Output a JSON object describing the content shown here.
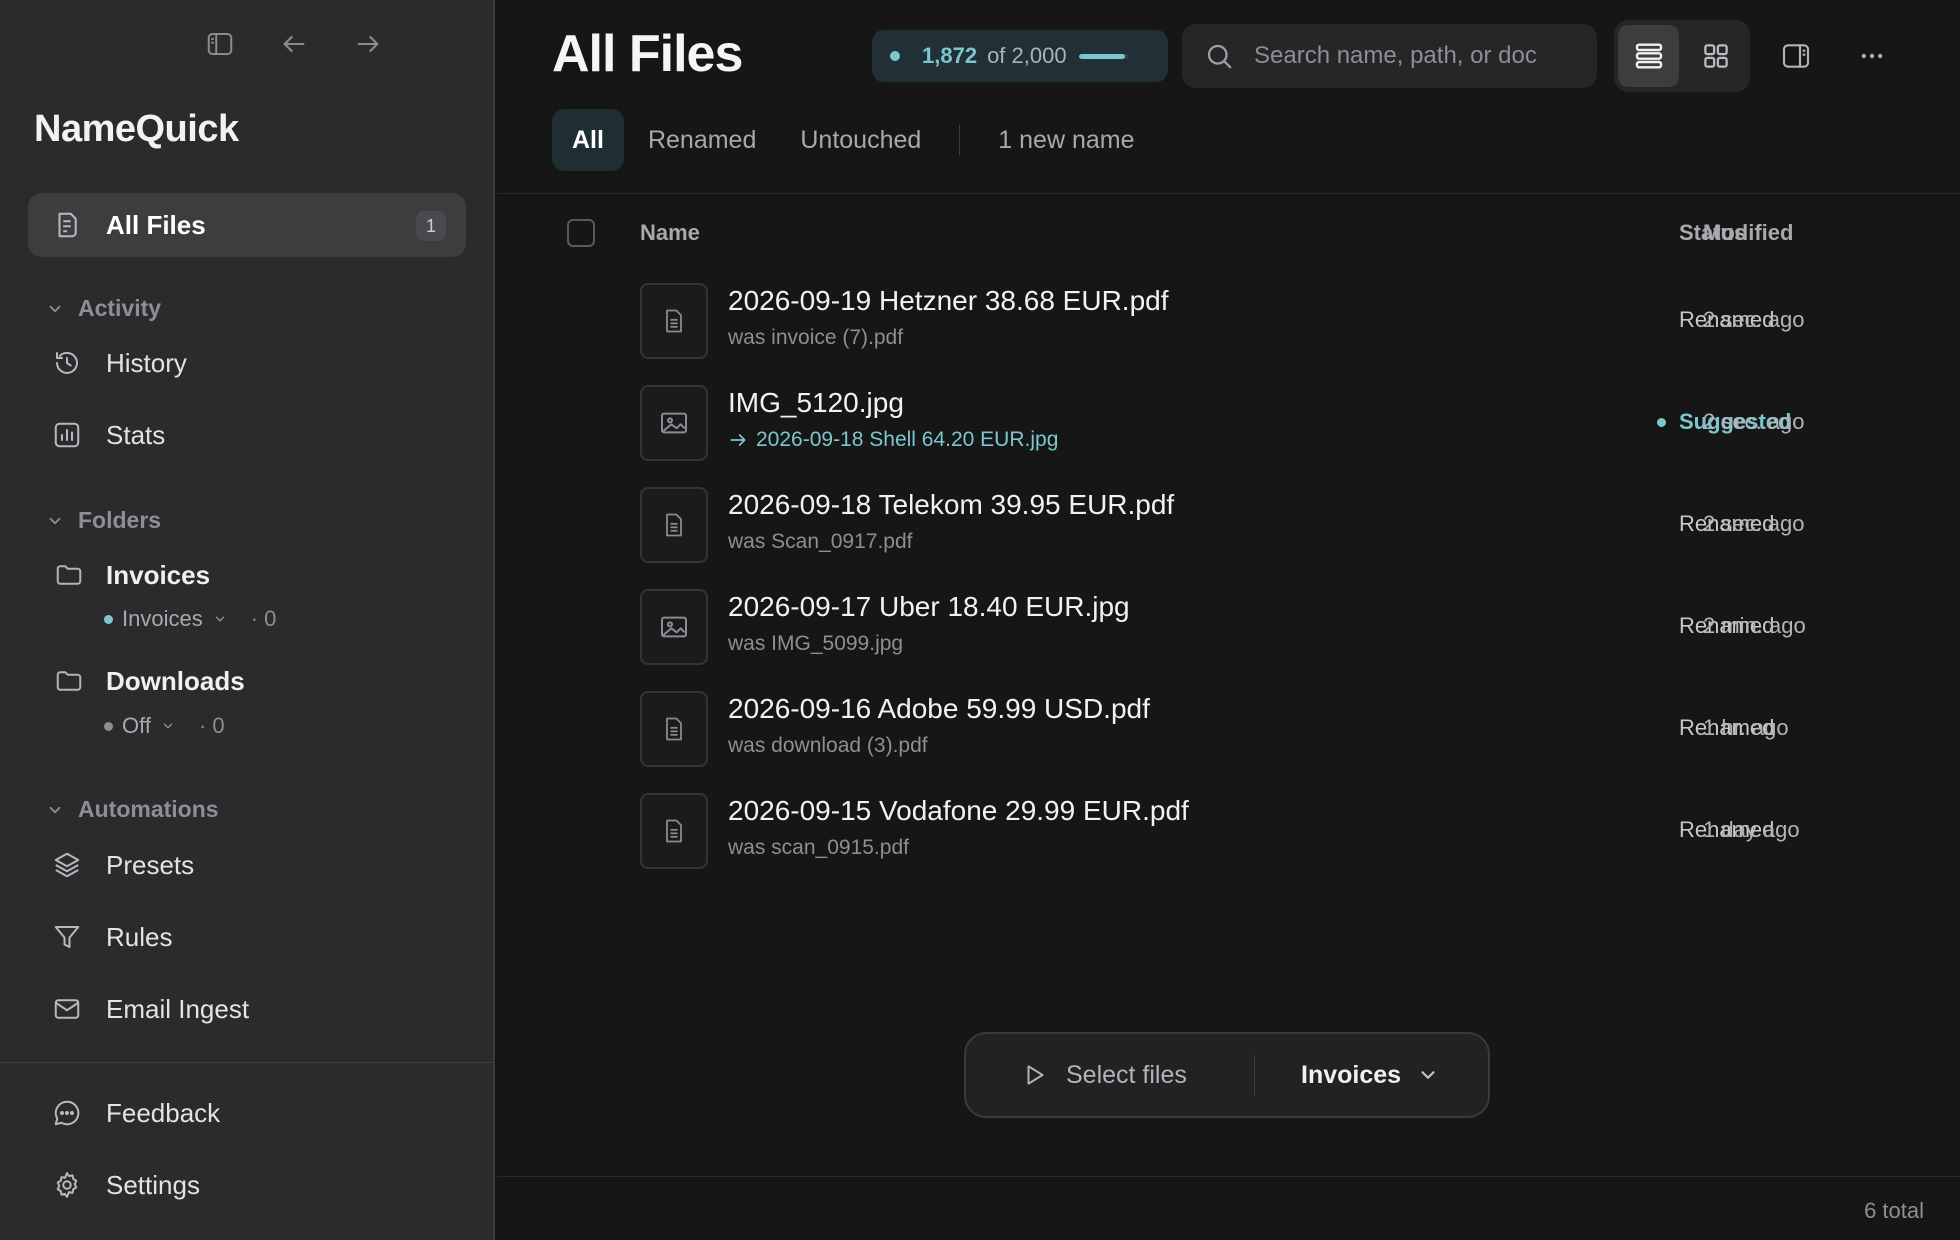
{
  "theme": {
    "accent": "#7cc6cf",
    "status_suggested": "#7cc6cf",
    "folder_active_dot": "#7cc6cf",
    "folder_off_dot": "#8e8e93"
  },
  "window": {
    "icons": [
      "sidebar-toggle-icon",
      "arrow-left-icon",
      "arrow-right-icon"
    ]
  },
  "sidebar": {
    "app_name": "NameQuick",
    "all_files": {
      "label": "All Files",
      "badge": "1",
      "icon": "document-icon"
    },
    "sections": {
      "activity": "Activity",
      "folders": "Folders",
      "automations": "Automations"
    },
    "activity_items": [
      {
        "label": "History",
        "icon": "history-icon"
      },
      {
        "label": "Stats",
        "icon": "chart-icon"
      }
    ],
    "folders": [
      {
        "name": "Invoices",
        "preset": "Invoices",
        "count": "· 0",
        "active": true
      },
      {
        "name": "Downloads",
        "preset": "Off",
        "count": "· 0",
        "active": false
      }
    ],
    "automation_items": [
      {
        "label": "Presets",
        "icon": "layers-icon"
      },
      {
        "label": "Rules",
        "icon": "filter-icon"
      },
      {
        "label": "Email Ingest",
        "icon": "mail-icon"
      }
    ],
    "bottom_items": [
      {
        "label": "Feedback",
        "icon": "chat-bubble-icon"
      },
      {
        "label": "Settings",
        "icon": "gear-icon"
      }
    ]
  },
  "header": {
    "title": "All Files",
    "quota": {
      "used": "1,872",
      "of": "of 2,000",
      "fraction": 0.936
    },
    "search_placeholder": "Search name, path, or doc",
    "view_modes": [
      "list",
      "grid"
    ],
    "active_view": "list"
  },
  "tabs": {
    "items": [
      "All",
      "Renamed",
      "Untouched"
    ],
    "active": "All",
    "extra": "1 new name"
  },
  "table": {
    "columns": {
      "name": "Name",
      "status": "Status",
      "modified": "Modified"
    },
    "rows": [
      {
        "type": "pdf",
        "name": "2026-09-19 Hetzner 38.68 EUR.pdf",
        "sub": "was invoice (7).pdf",
        "suggested": false,
        "status": "Renamed",
        "modified": "2 sec. ago"
      },
      {
        "type": "image",
        "name": "IMG_5120.jpg",
        "sub": "2026-09-18 Shell 64.20 EUR.jpg",
        "suggested": true,
        "status": "Suggested",
        "modified": "2 sec. ago"
      },
      {
        "type": "pdf",
        "name": "2026-09-18 Telekom 39.95 EUR.pdf",
        "sub": "was Scan_0917.pdf",
        "suggested": false,
        "status": "Renamed",
        "modified": "2 sec. ago"
      },
      {
        "type": "image",
        "name": "2026-09-17 Uber 18.40 EUR.jpg",
        "sub": "was IMG_5099.jpg",
        "suggested": false,
        "status": "Renamed",
        "modified": "2 min. ago"
      },
      {
        "type": "pdf",
        "name": "2026-09-16 Adobe 59.99 USD.pdf",
        "sub": "was download (3).pdf",
        "suggested": false,
        "status": "Renamed",
        "modified": "1 hr. ago"
      },
      {
        "type": "pdf",
        "name": "2026-09-15 Vodafone 29.99 EUR.pdf",
        "sub": "was scan_0915.pdf",
        "suggested": false,
        "status": "Renamed",
        "modified": "1 day ago"
      }
    ]
  },
  "action_bar": {
    "select_label": "Select files",
    "preset_label": "Invoices"
  },
  "footer": {
    "total": "6 total"
  }
}
